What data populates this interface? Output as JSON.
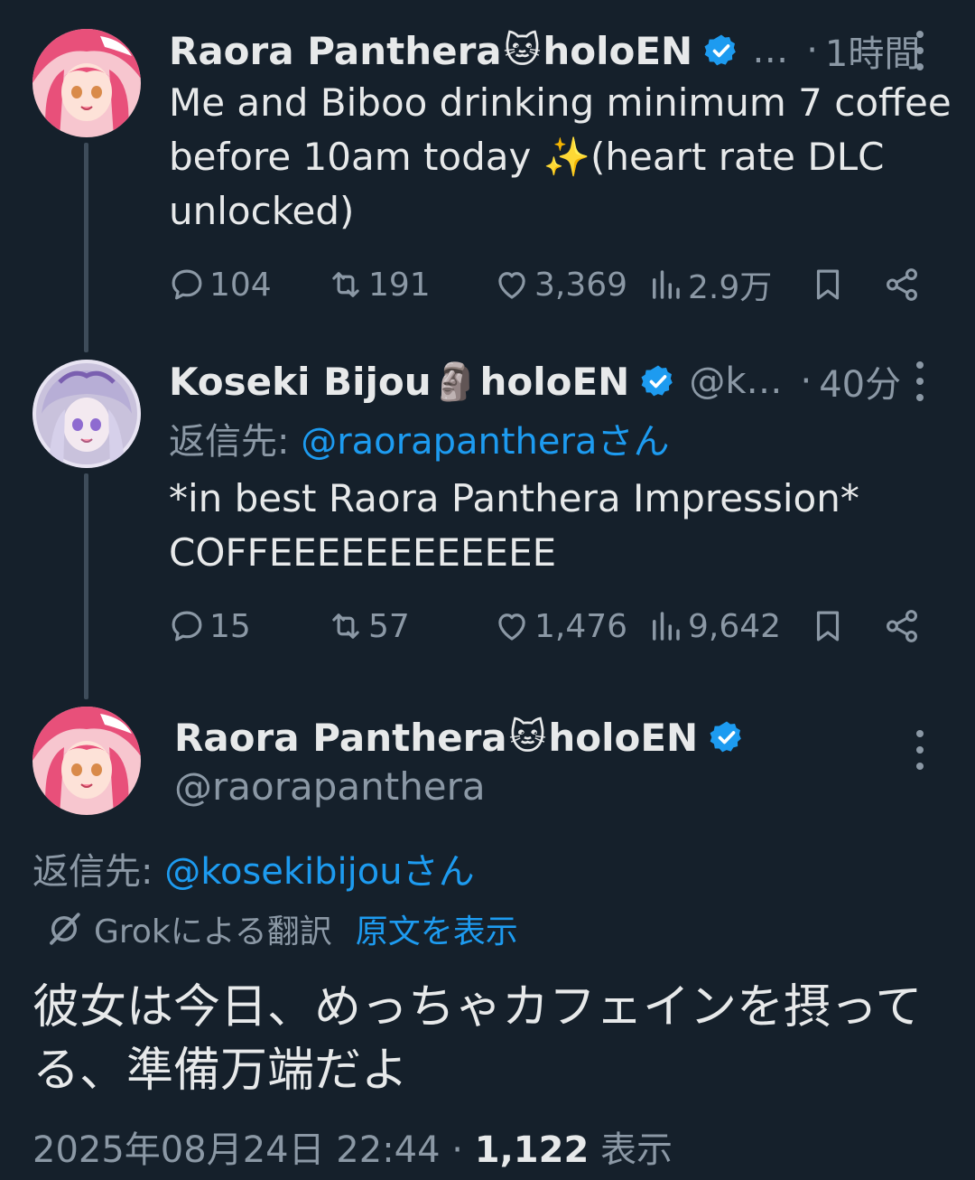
{
  "thread_tweets": [
    {
      "display_name": "Raora Panthera",
      "name_emoji": "🐱",
      "name_suffix": "holoEN",
      "handle_truncated": "…",
      "time": "1時間",
      "text_lines": [
        "Me and Biboo drinking minimum 7 coffee",
        "before 10am today ✨(heart rate DLC",
        "unlocked)"
      ],
      "stats": {
        "replies": "104",
        "reposts": "191",
        "likes": "3,369",
        "views": "2.9万"
      }
    },
    {
      "display_name": "Koseki Bijou",
      "name_emoji": "🗿",
      "name_suffix": "holoEN",
      "handle_truncated": "@k…",
      "time": "40分",
      "reply_prefix": "返信先: ",
      "reply_mention": "@raorapantheraさん",
      "text_lines": [
        "*in best Raora Panthera Impression*",
        "COFFEEEEEEEEEEEE"
      ],
      "stats": {
        "replies": "15",
        "reposts": "57",
        "likes": "1,476",
        "views": "9,642"
      }
    }
  ],
  "main_tweet": {
    "display_name": "Raora Panthera",
    "name_emoji": "🐱",
    "name_suffix": "holoEN",
    "handle": "@raorapanthera",
    "reply_prefix": "返信先: ",
    "reply_mention": "@kosekibijouさん",
    "translation_label": "Grokによる翻訳",
    "show_original": "原文を表示",
    "text_lines": [
      "彼女は今日、めっちゃカフェインを摂って",
      "る、準備万端だよ"
    ],
    "datetime": "2025年08月24日 22:44",
    "separator": " · ",
    "views_count": "1,122",
    "views_label": " 表示"
  },
  "colors": {
    "background": "#15202b",
    "text_primary": "#e7e9ea",
    "text_secondary": "#8b98a5",
    "accent": "#1d9bf0",
    "thread_line": "#3e4c5a"
  },
  "icons": [
    "reply-icon",
    "repost-icon",
    "like-icon",
    "views-icon",
    "bookmark-icon",
    "share-icon",
    "verified-icon",
    "more-icon",
    "grok-icon"
  ]
}
